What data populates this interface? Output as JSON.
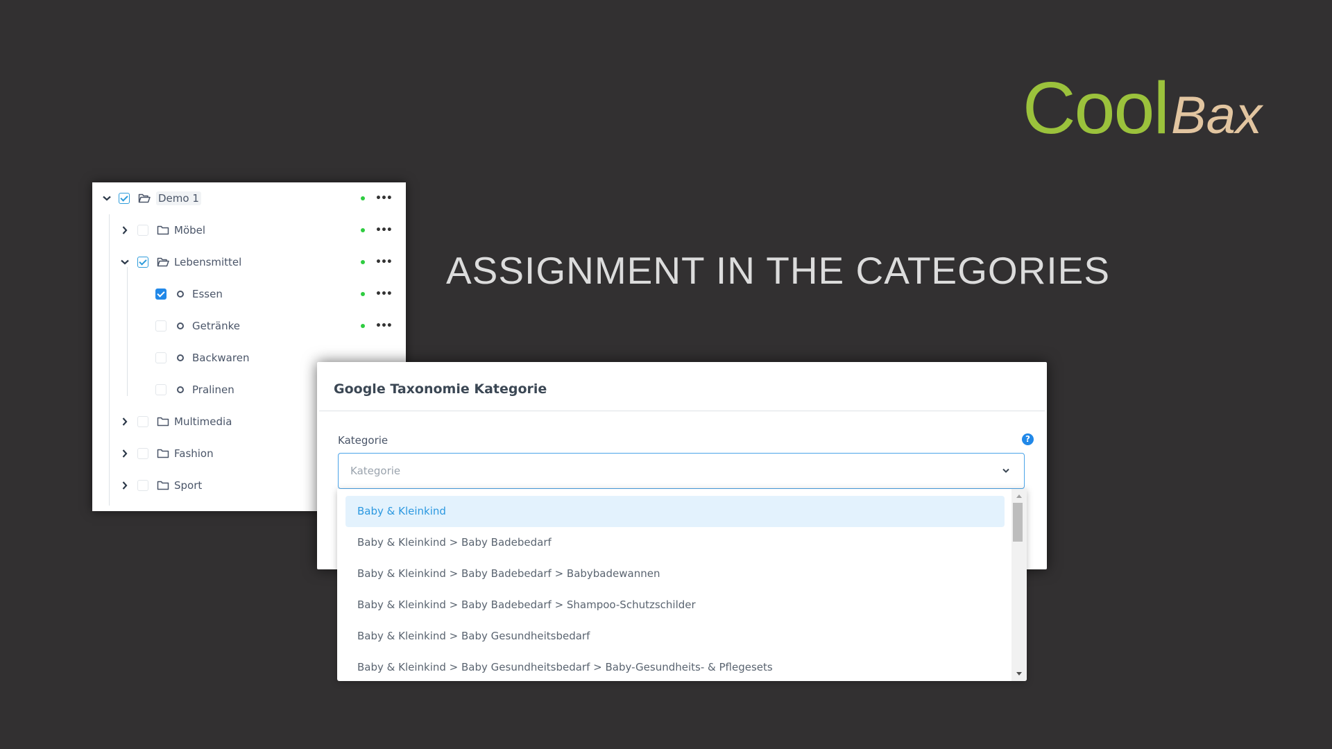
{
  "brand": {
    "cool": "Cool",
    "bax": "Bax",
    "cool_color": "#9bc23c",
    "bax_color": "#e2c5a0"
  },
  "headline": "ASSIGNMENT IN THE CATEGORIES",
  "tree": {
    "status_color": "#2ecc40",
    "items": [
      {
        "label": "Demo 1",
        "level": 0,
        "expanded": true,
        "check": "partial",
        "icon": "folder-open-icon",
        "status": true,
        "menu": "•••"
      },
      {
        "label": "Möbel",
        "level": 1,
        "expanded": false,
        "check": "none",
        "icon": "folder-icon",
        "status": true,
        "menu": "•••"
      },
      {
        "label": "Lebensmittel",
        "level": 1,
        "expanded": true,
        "check": "partial",
        "icon": "folder-open-icon",
        "status": true,
        "menu": "•••"
      },
      {
        "label": "Essen",
        "level": 2,
        "check": "checked",
        "icon": "leaf-icon",
        "status": true,
        "menu": "•••"
      },
      {
        "label": "Getränke",
        "level": 2,
        "check": "none",
        "icon": "leaf-icon",
        "status": true,
        "menu": "•••"
      },
      {
        "label": "Backwaren",
        "level": 2,
        "check": "none",
        "icon": "leaf-icon"
      },
      {
        "label": "Pralinen",
        "level": 2,
        "check": "none",
        "icon": "leaf-icon"
      },
      {
        "label": "Multimedia",
        "level": 1,
        "expanded": false,
        "check": "none",
        "icon": "folder-icon"
      },
      {
        "label": "Fashion",
        "level": 1,
        "expanded": false,
        "check": "none",
        "icon": "folder-icon"
      },
      {
        "label": "Sport",
        "level": 1,
        "expanded": false,
        "check": "none",
        "icon": "folder-icon"
      }
    ]
  },
  "dialog": {
    "title": "Google Taxonomie Kategorie",
    "field_label": "Kategorie",
    "help": "?",
    "select_placeholder": "Kategorie",
    "options": [
      "Baby & Kleinkind",
      "Baby & Kleinkind > Baby Badebedarf",
      "Baby & Kleinkind > Baby Badebedarf > Babybadewannen",
      "Baby & Kleinkind > Baby Badebedarf > Shampoo-Schutzschilder",
      "Baby & Kleinkind > Baby Gesundheitsbedarf",
      "Baby & Kleinkind > Baby Gesundheitsbedarf > Baby-Gesundheits- & Pflegesets"
    ],
    "active_option_index": 0,
    "accent": "#2188e8"
  }
}
